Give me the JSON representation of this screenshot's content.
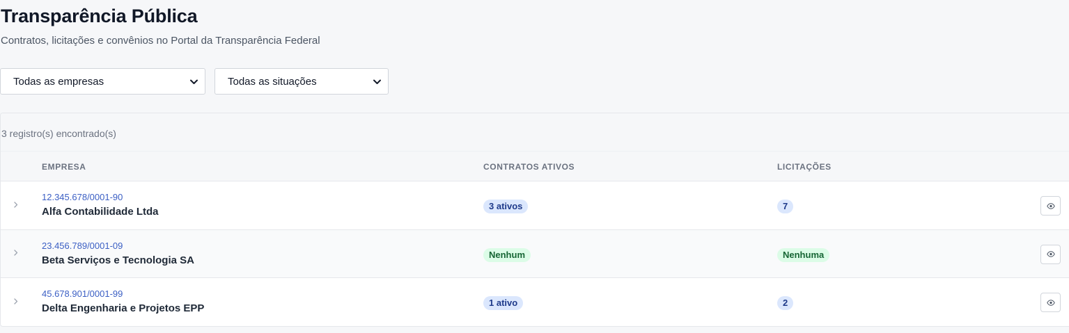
{
  "header": {
    "title": "Transparência Pública",
    "subtitle": "Contratos, licitações e convênios no Portal da Transparência Federal"
  },
  "filters": {
    "empresas": {
      "selected": "Todas as empresas",
      "icon": "chevron-down-icon"
    },
    "situacoes": {
      "selected": "Todas as situações",
      "icon": "chevron-down-icon"
    }
  },
  "results": {
    "count_text": "3 registro(s) encontrado(s)"
  },
  "table": {
    "columns": {
      "empresa": "EMPRESA",
      "contratos": "CONTRATOS ATIVOS",
      "licitacoes": "LICITAÇÕES"
    },
    "rows": [
      {
        "cnpj": "12.345.678/0001-90",
        "name": "Alfa Contabilidade Ltda",
        "contratos": {
          "text": "3 ativos",
          "status": "blue"
        },
        "licitacoes": {
          "text": "7",
          "status": "blue"
        }
      },
      {
        "cnpj": "23.456.789/0001-09",
        "name": "Beta Serviços e Tecnologia SA",
        "contratos": {
          "text": "Nenhum",
          "status": "green"
        },
        "licitacoes": {
          "text": "Nenhuma",
          "status": "green"
        }
      },
      {
        "cnpj": "45.678.901/0001-99",
        "name": "Delta Engenharia e Projetos EPP",
        "contratos": {
          "text": "1 ativo",
          "status": "blue"
        },
        "licitacoes": {
          "text": "2",
          "status": "blue"
        }
      }
    ]
  },
  "colors": {
    "badge_blue_bg": "#dbe7fd",
    "badge_green_bg": "#dcfce7",
    "link": "#3b5fc4"
  },
  "icons": {
    "expander": "chevron-right-icon",
    "view": "eye-icon"
  }
}
